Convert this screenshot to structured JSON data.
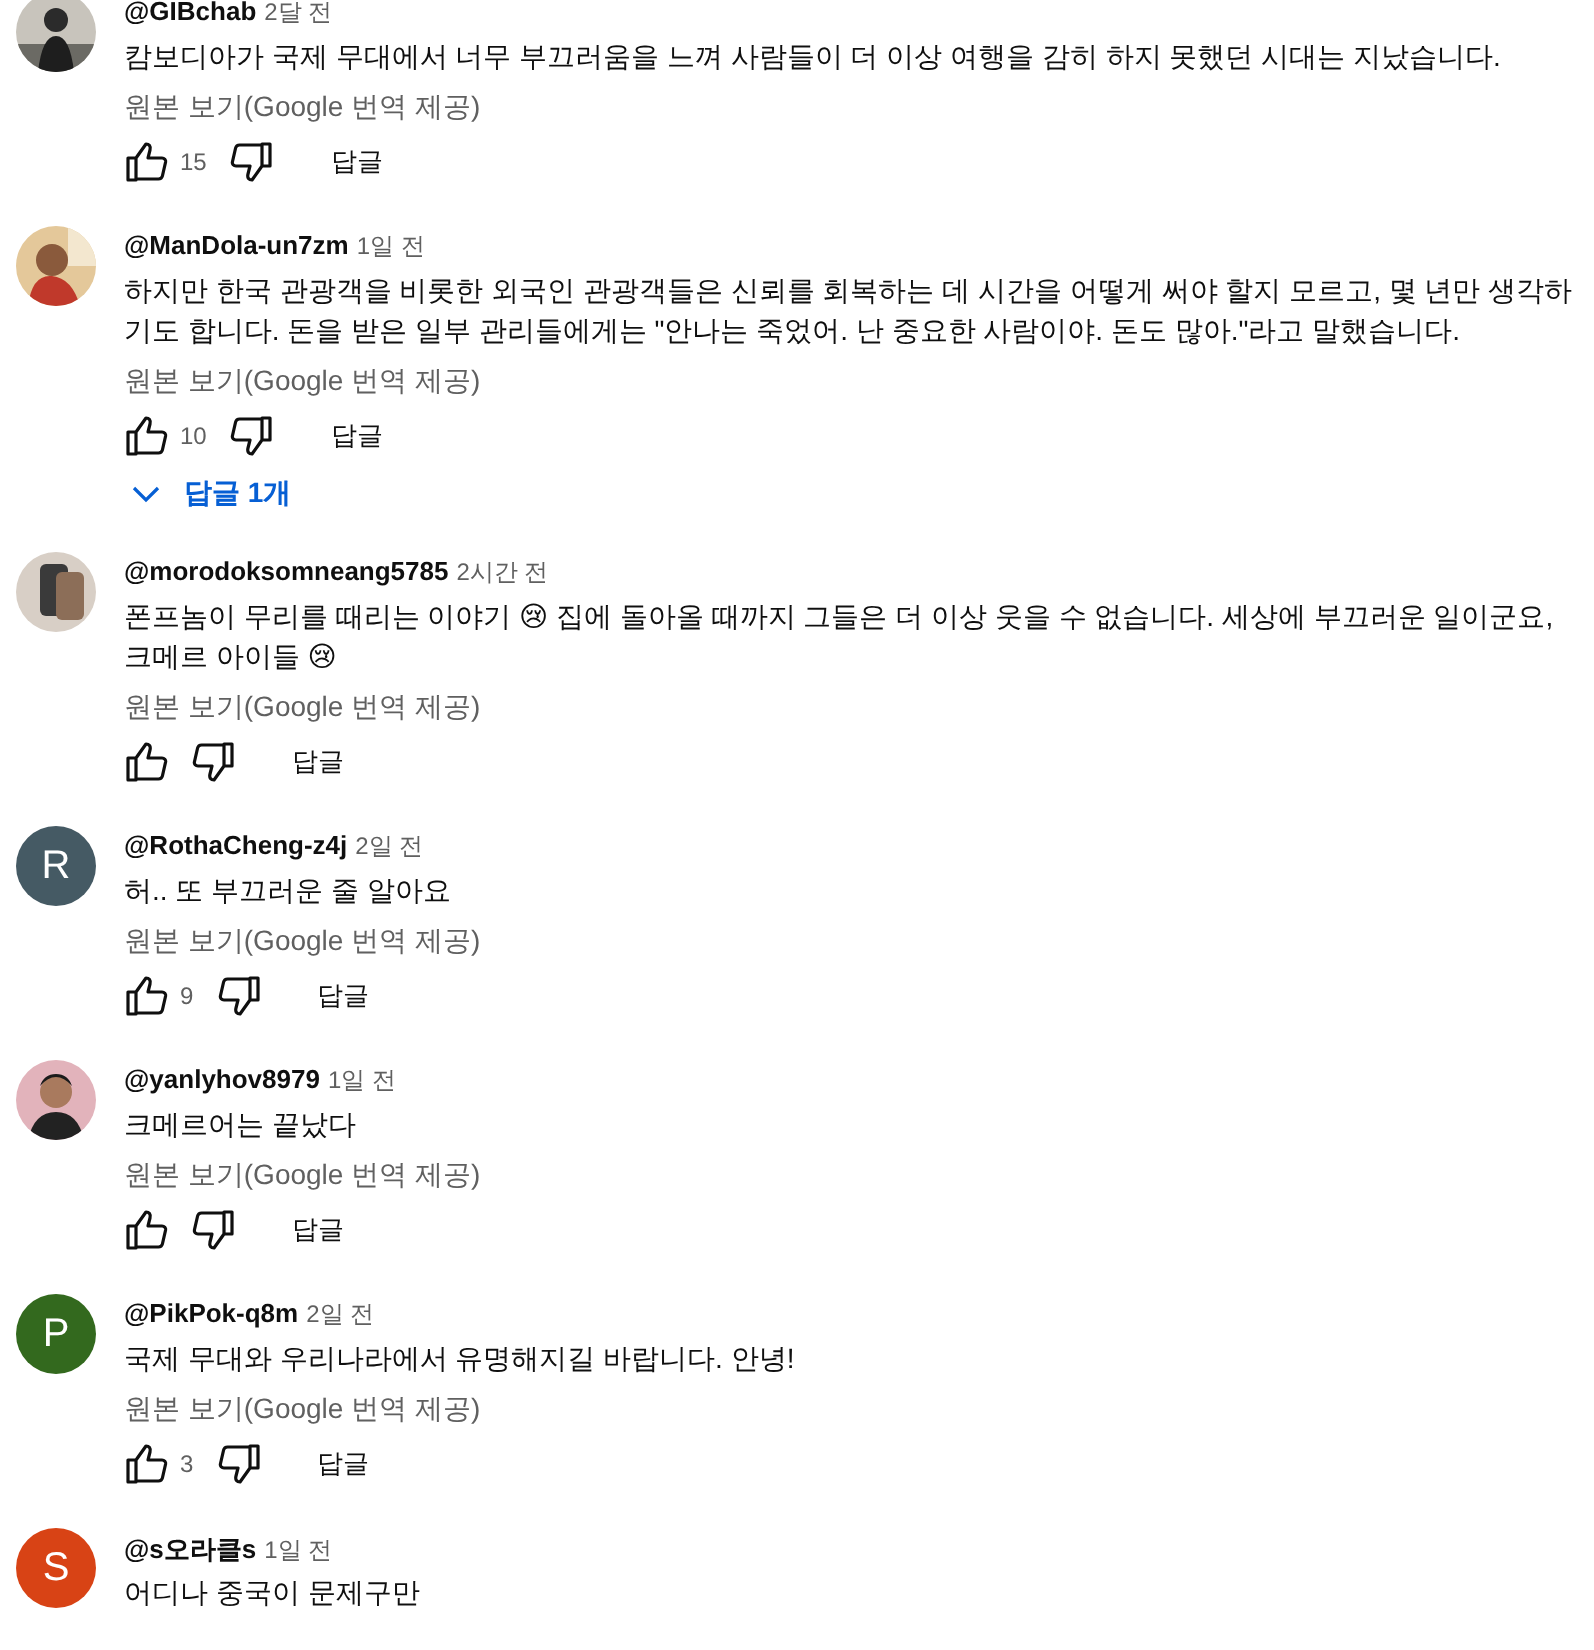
{
  "comments": [
    {
      "author": "@GIBchab",
      "time": "2달 전",
      "body": [
        {
          "kind": "text",
          "text": "캄보디아가 국제 무대에서 너무 부끄러움을 느껴 사람들이 더 이상 여행을 감히 하지 못했던 시대는 지났습니다."
        }
      ],
      "translation": "원본 보기(Google 번역 제공)",
      "likes": "15",
      "reply": "답글"
    },
    {
      "author": "@ManDola-un7zm",
      "time": "1일 전",
      "body": [
        {
          "kind": "text",
          "text": "하지만 한국 관광객을 비롯한 외국인 관광객들은 신뢰를 회복하는 데 시간을 어떻게 써야 할지 모르고, 몇 년만 생각하기도 합니다. 돈을 받은 일부 관리들에게는 \"안나는 죽었어. 난 중요한 사람이야. 돈도 많아.\"라고 말했습니다."
        }
      ],
      "translation": "원본 보기(Google 번역 제공)",
      "likes": "10",
      "reply": "답글",
      "replies": "답글 1개"
    },
    {
      "author": "@morodoksomneang5785",
      "time": "2시간 전",
      "body": [
        {
          "kind": "text",
          "text": "폰프놈이 무리를 때리는 이야기 😢 집에 돌아올 때까지 그들은 더 이상 웃을 수 없습니다. 세상에 부끄러운 일이군요, 크메르 아이들 😢"
        }
      ],
      "translation": "원본 보기(Google 번역 제공)",
      "reply": "답글"
    },
    {
      "author": "@RothaCheng-z4j",
      "time": "2일 전",
      "avatar": {
        "kind": "letter",
        "letter": "R",
        "color": "#455a64"
      },
      "body": [
        {
          "kind": "text",
          "text": "허.. 또 부끄러운 줄 알아요"
        }
      ],
      "translation": "원본 보기(Google 번역 제공)",
      "likes": "9",
      "reply": "답글"
    },
    {
      "author": "@yanlyhov8979",
      "time": "1일 전",
      "body": [
        {
          "kind": "text",
          "text": "크메르어는 끝났다"
        }
      ],
      "translation": "원본 보기(Google 번역 제공)",
      "reply": "답글"
    },
    {
      "author": "@PikPok-q8m",
      "time": "2일 전",
      "avatar": {
        "kind": "letter",
        "letter": "P",
        "color": "#33691e"
      },
      "body": [
        {
          "kind": "text",
          "text": "국제 무대와 우리나라에서 유명해지길 바랍니다. 안녕!"
        }
      ],
      "translation": "원본 보기(Google 번역 제공)",
      "likes": "3",
      "reply": "답글"
    },
    {
      "author": "@s오라클s",
      "time": "1일 전",
      "avatar": {
        "kind": "letter",
        "letter": "S",
        "color": "#d84315"
      },
      "body": [
        {
          "kind": "text",
          "text": "어디나 중국이 문제구만"
        }
      ]
    }
  ]
}
